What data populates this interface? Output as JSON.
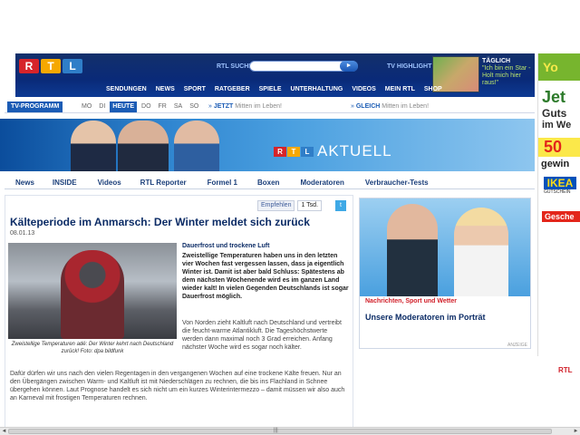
{
  "header": {
    "logo": [
      "R",
      "T",
      "L"
    ],
    "search_label": "RTL SUCHE",
    "search_placeholder": "",
    "search_button": "►",
    "tv_highlight_label": "TV HIGHLIGHT",
    "highlight": {
      "title": "TÄGLICH",
      "sub1": "\"Ich bin ein Star -",
      "sub2": "Holt mich hier raus!\""
    },
    "nav": [
      "SENDUNGEN",
      "NEWS",
      "SPORT",
      "RATGEBER",
      "SPIELE",
      "UNTERHALTUNG",
      "VIDEOS",
      "MEIN RTL",
      "SHOP"
    ]
  },
  "tv_bar": {
    "label": "TV-PROGRAMM",
    "days": [
      "MO",
      "DI",
      "HEUTE",
      "DO",
      "FR",
      "SA",
      "SO"
    ],
    "active_day": "HEUTE",
    "arrow": "»",
    "now_label": "JETZT",
    "now_text": "Mitten im Leben!",
    "soon_label": "GLEICH",
    "soon_text": "Mitten im Leben!"
  },
  "banner": {
    "logo": [
      "R",
      "T",
      "L"
    ],
    "title": "AKTUELL"
  },
  "sub_nav": [
    "News",
    "INSIDE",
    "Videos",
    "RTL Reporter",
    "Formel 1",
    "Boxen",
    "Moderatoren",
    "Verbraucher-Tests"
  ],
  "article": {
    "share_label": "Empfehlen",
    "share_count": "1 Tsd.",
    "headline": "Kälteperiode im Anmarsch: Der Winter meldet sich zurück",
    "date": "08.01.13",
    "photo_caption": "Zweistellige Temperaturen adé: Der Winter kehrt nach Deutschland zurück! Foto: dpa bildfunk",
    "subhead": "Dauerfrost und trockene Luft",
    "lead": "Zweistellige Temperaturen haben uns in den letzten vier Wochen fast vergessen lassen, dass ja eigentlich Winter ist. Damit ist aber bald Schluss: Spätestens ab dem nächsten Wochenende wird es im ganzen Land wieder kalt! In vielen Gegenden Deutschlands ist sogar Dauerfrost möglich.",
    "para1": "Von Norden zieht Kaltluft nach Deutschland und vertreibt die feucht-warme Atlantikluft. Die Tageshöchstwerte werden dann maximal noch 3 Grad erreichen. Anfang nächster Woche wird es sogar noch kälter.",
    "para2": "Dafür dürfen wir uns nach den vielen Regentagen in den vergangenen Wochen auf eine trockene Kälte freuen. Nur an den Übergängen zwischen Warm- und Kaltluft ist mit Niederschlägen zu rechnen, die bis ins Flachland in Schnee übergehen können. Laut Prognose handelt es sich nicht um ein kurzes Winterintermezzo – damit müssen wir also auch an Karneval mit frostigen Temperaturen rechnen."
  },
  "moderators": {
    "caption": "Nachrichten, Sport und Wetter",
    "title": "Unsere Moderatoren im Porträt",
    "ad_label": "ANZEIGE"
  },
  "side_ad": {
    "top": "Yo",
    "line1": "Jet",
    "line2": "Guts",
    "line3": "im We",
    "amount": "50",
    "line4": "gewin",
    "brand": "IKEA",
    "voucher": "GUTSCHEIN",
    "bottom": "Gesche",
    "rtl": "RTL"
  },
  "scrollbar": {
    "left": "◄",
    "right": "►",
    "grip": "|||"
  }
}
